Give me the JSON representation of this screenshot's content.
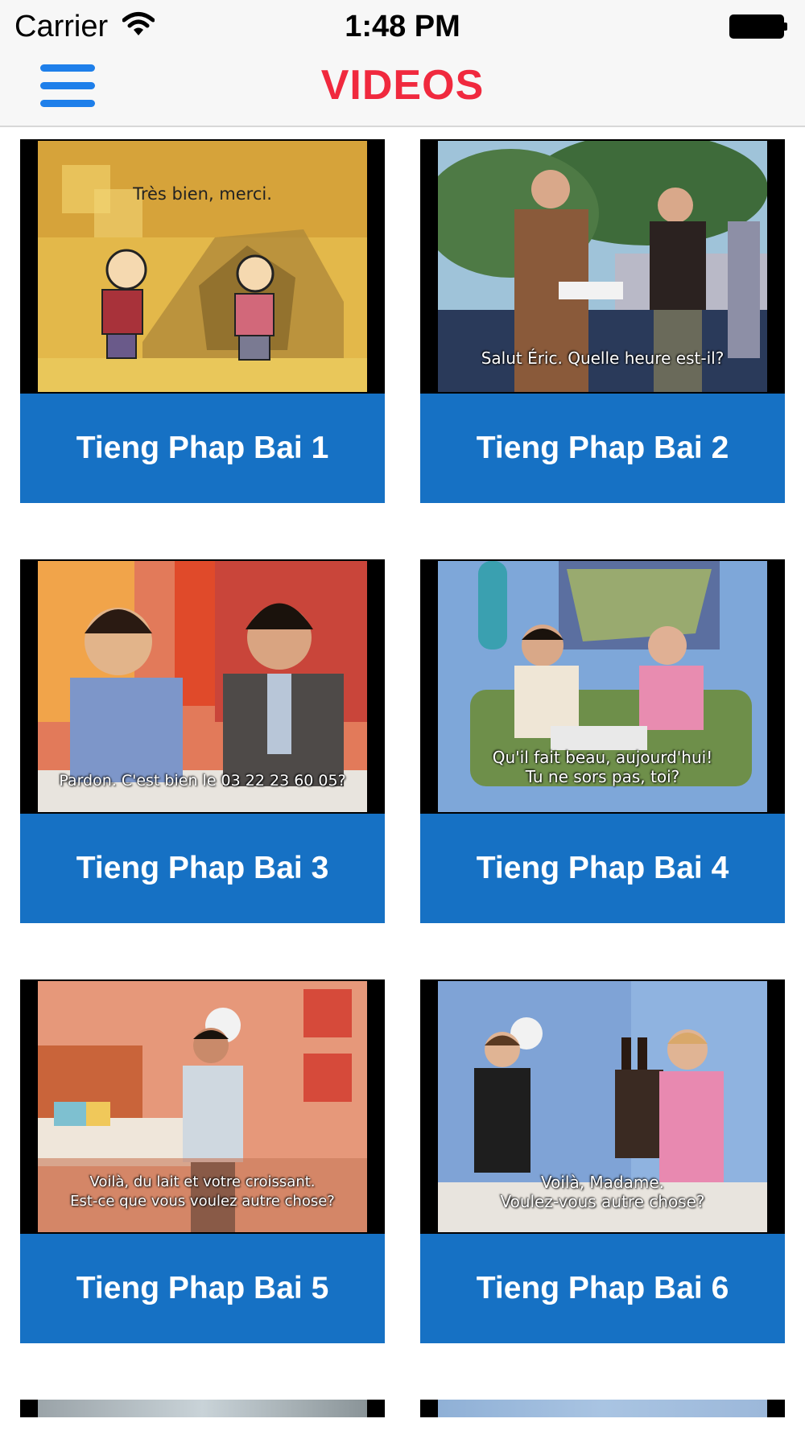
{
  "status_bar": {
    "carrier": "Carrier",
    "time": "1:48 PM"
  },
  "nav": {
    "title": "VIDEOS",
    "menu_icon": "hamburger-menu-icon",
    "title_color": "#f0293e",
    "accent": "#1e7fea"
  },
  "card_color": "#1671c4",
  "videos": [
    {
      "title": "Tieng Phap Bai 1",
      "subtitle_lines": [
        "Très bien, merci."
      ]
    },
    {
      "title": "Tieng Phap Bai 2",
      "subtitle_lines": [
        "Salut Éric. Quelle heure est-il?"
      ]
    },
    {
      "title": "Tieng Phap Bai 3",
      "subtitle_lines": [
        "Pardon. C'est bien le 03 22 23 60 05?"
      ]
    },
    {
      "title": "Tieng Phap Bai 4",
      "subtitle_lines": [
        "Qu'il fait beau, aujourd'hui!",
        "Tu ne sors pas, toi?"
      ]
    },
    {
      "title": "Tieng Phap Bai 5",
      "subtitle_lines": [
        "Voilà, du lait et votre croissant.",
        "Est-ce que vous voulez autre chose?"
      ]
    },
    {
      "title": "Tieng Phap Bai 6",
      "subtitle_lines": [
        "Voilà, Madame.",
        "Voulez-vous autre chose?"
      ]
    }
  ]
}
